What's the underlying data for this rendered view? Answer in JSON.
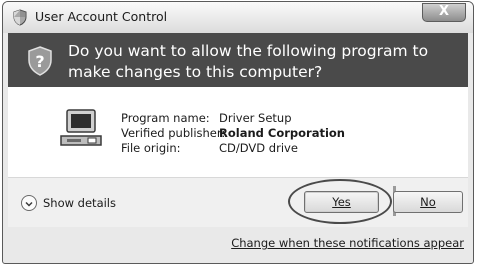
{
  "window": {
    "title": "User Account Control",
    "close_label": "X"
  },
  "banner": {
    "question": "Do you want to allow the following program to make changes to this computer?"
  },
  "program": {
    "name_label": "Program name:",
    "name_value": "Driver Setup",
    "publisher_label": "Verified publisher:",
    "publisher_value": "Roland Corporation",
    "origin_label": "File origin:",
    "origin_value": "CD/DVD drive"
  },
  "buttons": {
    "show_details_label": "Show details",
    "yes_label": "Yes",
    "no_label": "No"
  },
  "footer": {
    "link_label": "Change when these notifications appear"
  },
  "icons": {
    "title": "uac-shield-icon",
    "banner": "shield-question-icon",
    "program": "computer-icon",
    "details": "chevron-down-icon"
  }
}
